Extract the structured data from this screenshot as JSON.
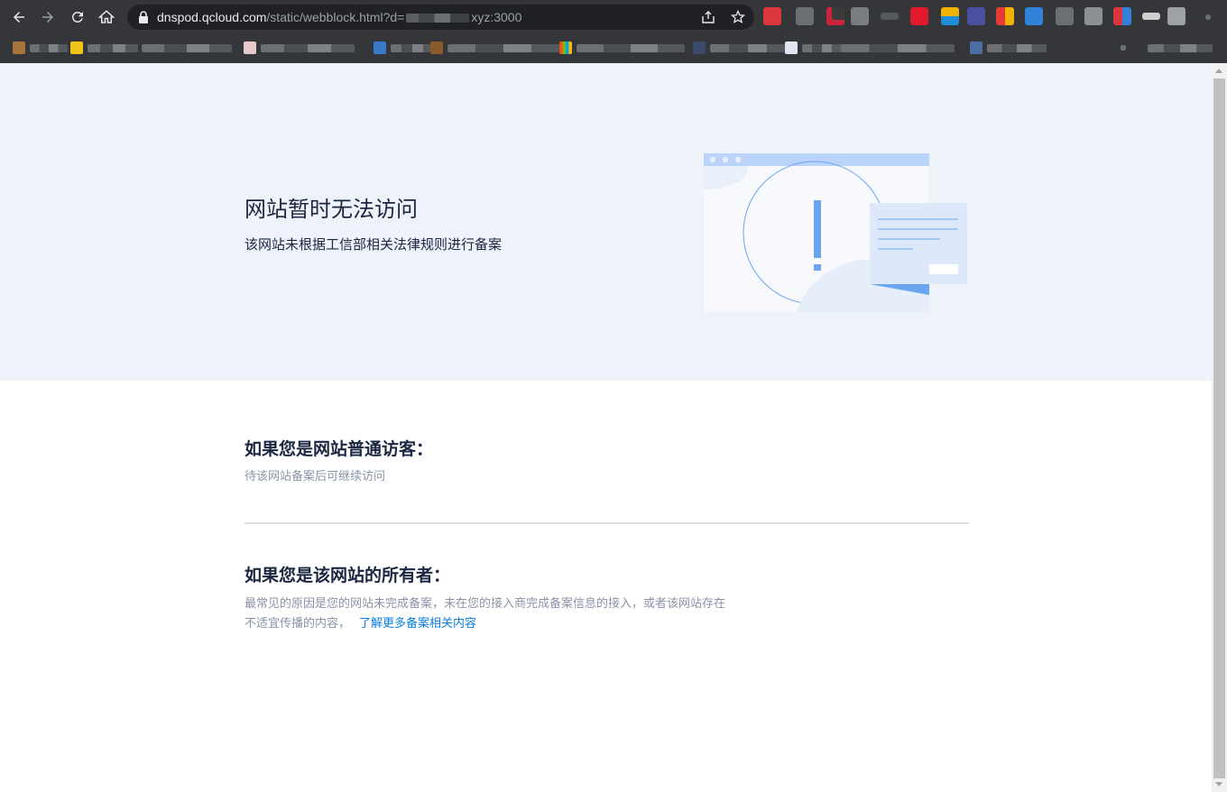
{
  "browser": {
    "url_host": "dnspod.qcloud.com",
    "url_path": "/static/webblock.html?d=",
    "url_tail": "xyz:3000",
    "icons": [
      "back-icon",
      "forward-icon",
      "reload-icon",
      "home-icon",
      "lock-icon",
      "share-icon",
      "star-icon"
    ]
  },
  "hero": {
    "title": "网站暂时无法访问",
    "subtitle": "该网站未根据工信部相关法律规则进行备案"
  },
  "visitor": {
    "title": "如果您是网站普通访客：",
    "text": "待该网站备案后可继续访问"
  },
  "owner": {
    "title": "如果您是该网站的所有者：",
    "text_line1": "最常见的原因是您的网站未完成备案，未在您的接入商完成备案信息的接入，或者该网站存在",
    "text_line2": "不适宜传播的内容，",
    "link": "了解更多备案相关内容"
  },
  "colors": {
    "hero_bg": "#eef3fa",
    "link": "#0a7ee6",
    "title": "#1b2740",
    "muted": "#8a94a6",
    "illustration_blue": "#6aa6f0"
  }
}
